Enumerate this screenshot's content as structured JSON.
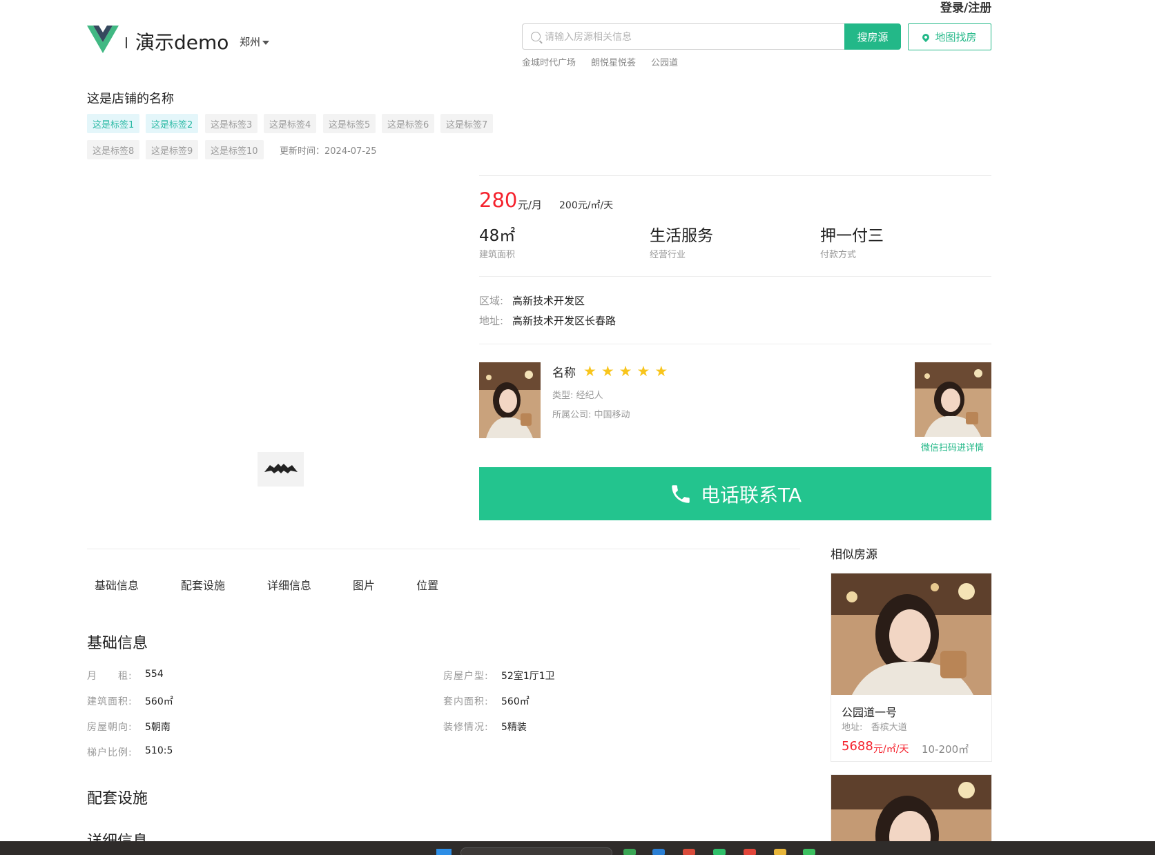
{
  "header": {
    "login": "登录/注册",
    "site_title": "演示demo",
    "city": "郑州",
    "search_placeholder": "请输入房源相关信息",
    "search_button": "搜房源",
    "map_button": "地图找房",
    "hot_words": [
      "金城时代广场",
      "朗悦星悦荟",
      "公园道"
    ]
  },
  "store": {
    "name": "这是店铺的名称",
    "tags": [
      {
        "label": "这是标签1",
        "active": true
      },
      {
        "label": "这是标签2",
        "active": true
      },
      {
        "label": "这是标签3",
        "active": false
      },
      {
        "label": "这是标签4",
        "active": false
      },
      {
        "label": "这是标签5",
        "active": false
      },
      {
        "label": "这是标签6",
        "active": false
      },
      {
        "label": "这是标签7",
        "active": false
      },
      {
        "label": "这是标签8",
        "active": false
      },
      {
        "label": "这是标签9",
        "active": false
      },
      {
        "label": "这是标签10",
        "active": false
      }
    ],
    "update_time": "更新时间：2024-07-25"
  },
  "price": {
    "value": "280",
    "unit": "元/月",
    "per_day": "200元/㎡/天"
  },
  "stats": [
    {
      "value": "48㎡",
      "label": "建筑面积"
    },
    {
      "value": "生活服务",
      "label": "经营行业"
    },
    {
      "value": "押一付三",
      "label": "付款方式"
    }
  ],
  "location": {
    "district_label": "区域:",
    "district": "高新技术开发区",
    "address_label": "地址:",
    "address": "高新技术开发区长春路"
  },
  "agent": {
    "name": "名称",
    "rating": 5,
    "type": "类型: 经纪人",
    "company": "所属公司: 中国移动",
    "qr_tip": "微信扫码进详情"
  },
  "call_button": "电话联系TA",
  "tabs": [
    "基础信息",
    "配套设施",
    "详细信息",
    "图片",
    "位置"
  ],
  "basic_info": {
    "title": "基础信息",
    "rows": [
      {
        "label": "月　　租:",
        "value": "554"
      },
      {
        "label": "房屋户型:",
        "value": "52室1厅1卫"
      },
      {
        "label": "建筑面积:",
        "value": "560㎡"
      },
      {
        "label": "套内面积:",
        "value": "560㎡"
      },
      {
        "label": "房屋朝向:",
        "value": "5朝南"
      },
      {
        "label": "装修情况:",
        "value": "5精装"
      },
      {
        "label": "梯户比例:",
        "value": "510:5"
      }
    ]
  },
  "facilities_title": "配套设施",
  "details_title": "详细信息",
  "similar": {
    "title": "相似房源",
    "cards": [
      {
        "name": "公园道一号",
        "addr_label": "地址:",
        "addr": "香槟大道",
        "price": "5688",
        "price_unit": "元/㎡/天",
        "area": "10-200㎡"
      }
    ]
  },
  "colors": {
    "accent": "#23b888",
    "price": "#f5222d",
    "star": "#f8c51c"
  }
}
